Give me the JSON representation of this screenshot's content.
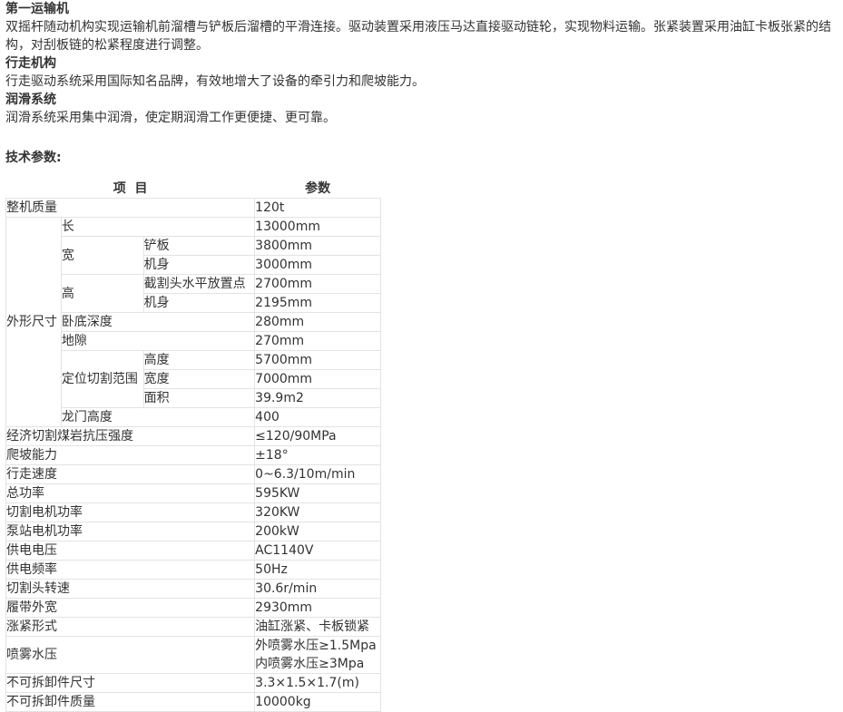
{
  "sections": [
    {
      "title": "第一运输机",
      "body": "双摇杆随动机构实现运输机前溜槽与铲板后溜槽的平滑连接。驱动装置采用液压马达直接驱动链轮，实现物料运输。张紧装置采用油缸卡板张紧的结构，对刮板链的松紧程度进行调整。"
    },
    {
      "title": "行走机构",
      "body": "行走驱动系统采用国际知名品牌，有效地增大了设备的牵引力和爬坡能力。"
    },
    {
      "title": "润滑系统",
      "body": "润滑系统采用集中润滑，使定期润滑工作更便捷、更可靠。"
    }
  ],
  "spec": {
    "title": "技术参数:",
    "col_item": "项  目",
    "col_param": "参数",
    "rows": {
      "mass_label": "整机质量",
      "mass": "120t",
      "dim_label": "外形尺寸",
      "len_label": "长",
      "len": "13000mm",
      "wid_label": "宽",
      "wid_shovel_label": "铲板",
      "wid_shovel": "3800mm",
      "wid_body_label": "机身",
      "wid_body": "3000mm",
      "hei_label": "高",
      "hei_head_label": "截割头水平放置点",
      "hei_head": "2700mm",
      "hei_body_label": "机身",
      "hei_body": "2195mm",
      "depth_label": "卧底深度",
      "depth": "280mm",
      "clear_label": "地隙",
      "clear": "270mm",
      "range_label": "定位切割范围",
      "range_h_label": "高度",
      "range_h": "5700mm",
      "range_w_label": "宽度",
      "range_w": "7000mm",
      "range_a_label": "面积",
      "range_a": "39.9m2",
      "gantry_label": "龙门高度",
      "gantry": "400",
      "strength_label": "经济切割煤岩抗压强度",
      "strength": "≤120/90MPa",
      "climb_label": "爬坡能力",
      "climb": "±18°",
      "speed_label": "行走速度",
      "speed": "0~6.3/10m/min",
      "power_label": "总功率",
      "power": "595KW",
      "cut_power_label": "切割电机功率",
      "cut_power": "320KW",
      "pump_power_label": "泵站电机功率",
      "pump_power": "200kW",
      "voltage_label": "供电电压",
      "voltage": "AC1140V",
      "freq_label": "供电频率",
      "freq": "50Hz",
      "rpm_label": "切割头转速",
      "rpm": "30.6r/min",
      "track_label": "履带外宽",
      "track": "2930mm",
      "tension_label": "涨紧形式",
      "tension": "油缸涨紧、卡板锁紧",
      "spray_label": "喷雾水压",
      "spray_out": "外喷雾水压≥1.5Mpa",
      "spray_in": "内喷雾水压≥3Mpa",
      "part_size_label": "不可拆卸件尺寸",
      "part_size": "3.3×1.5×1.7(m)",
      "part_mass_label": "不可拆卸件质量",
      "part_mass": "10000kg"
    }
  }
}
